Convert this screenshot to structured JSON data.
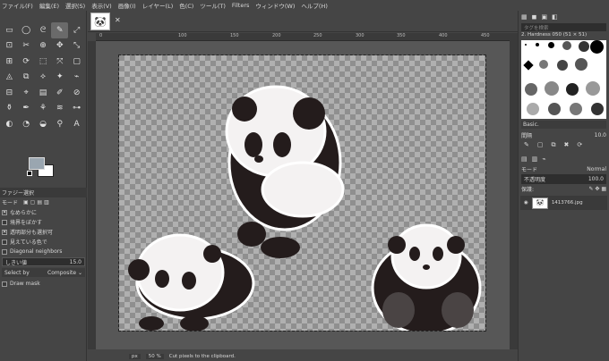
{
  "menubar": [
    "ファイル(F)",
    "編集(E)",
    "選択(S)",
    "表示(V)",
    "画像(I)",
    "レイヤー(L)",
    "色(C)",
    "ツール(T)",
    "Filters",
    "ウィンドウ(W)",
    "ヘルプ(H)"
  ],
  "tools": [
    "▭",
    "◯",
    "ᘓ",
    "✎",
    "⤢",
    "⊡",
    "✂",
    "⊕",
    "✥",
    "⤡",
    "⊞",
    "⟳",
    "⬚",
    "⤧",
    "▢",
    "◬",
    "⧉",
    "⟡",
    "✦",
    "⌁",
    "⊟",
    "⌖",
    "▤",
    "✐",
    "⊘",
    "⚱",
    "✒",
    "⚘",
    "≋",
    "⊶",
    "◐",
    "◔",
    "◒",
    "⚲",
    "A"
  ],
  "tool_options": {
    "title": "ファジー選択",
    "mode_label": "モード",
    "antialias": "なめらかに",
    "feather": "境界をぼかす",
    "select_transparent": "透明部分も選択可",
    "sample_merged": "見えている色で",
    "diagonal": "Diagonal neighbors",
    "threshold_label": "しきい値",
    "threshold_value": "15.0",
    "select_by_label": "Select by",
    "select_by_value": "Composite",
    "draw_mask": "Draw mask"
  },
  "image_tab": {
    "thumb": "🐼",
    "close": "✕"
  },
  "ruler_ticks": [
    "0",
    "100",
    "150",
    "200",
    "250",
    "300",
    "350",
    "400",
    "450"
  ],
  "status": {
    "unit": "px",
    "zoom": "50 %",
    "message": "Cut pixels to the clipboard."
  },
  "right_panel": {
    "search_placeholder": "タグを検索",
    "brush_name": "2. Hardness 050 (51 × 51)",
    "brush_set": "Basic.",
    "spacing_label": "間隔",
    "spacing_value": "10.0",
    "layers_mode_label": "モード",
    "layers_mode_value": "Normal",
    "opacity_label": "不透明度",
    "opacity_value": "100.0",
    "lock_label": "保護:",
    "layer_name": "1413766.jpg"
  },
  "colors": {
    "fg": "#9aa6b0",
    "bg": "#ffffff"
  }
}
